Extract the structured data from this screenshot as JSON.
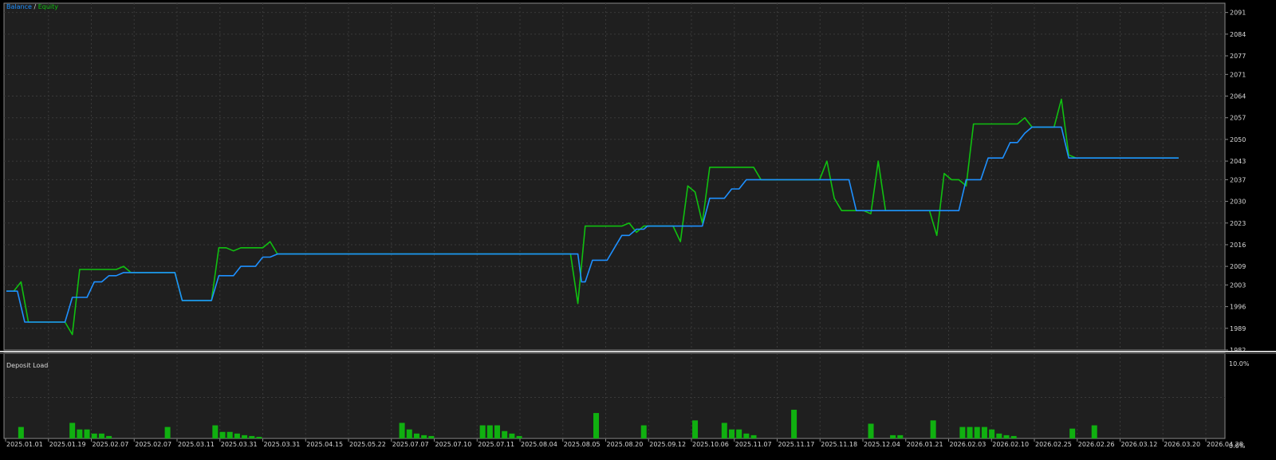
{
  "main_pane": {
    "legend_balance": "Balance",
    "legend_separator": " / ",
    "legend_equity": "Equity"
  },
  "sub_pane": {
    "title": "Deposit Load",
    "y_top_label": "10.0%",
    "y_bottom_label": "0.0%"
  },
  "colors": {
    "background": "#1f1f1f",
    "grid": "#3a3a3a",
    "balance": "#1e90ff",
    "equity": "#10c010",
    "deposit_load": "#10b010",
    "text": "#d8d8d8"
  },
  "chart_data": [
    {
      "type": "line",
      "series": [
        {
          "name": "Balance",
          "x": [
            0,
            3,
            5,
            10,
            12,
            14,
            16,
            18,
            20,
            22,
            24,
            26,
            28,
            30,
            32,
            34,
            36,
            38,
            40,
            42,
            44,
            46,
            48,
            50,
            52,
            54,
            56,
            58,
            60,
            62,
            64,
            66,
            68,
            70,
            72,
            74,
            76,
            78,
            80,
            82,
            84,
            86,
            88,
            90,
            92,
            94,
            96,
            98,
            100,
            102,
            104,
            106,
            108,
            110,
            112,
            114,
            116,
            118,
            120,
            122,
            124,
            126,
            128,
            130,
            132,
            134,
            136,
            138,
            140,
            142,
            144,
            146,
            148,
            150,
            152,
            154,
            156,
            157,
            158,
            160,
            162,
            164,
            166,
            168,
            170,
            172,
            174,
            175,
            176,
            178,
            180,
            182,
            184,
            186,
            188,
            189,
            190,
            192,
            194,
            196,
            198,
            200,
            202,
            204,
            206,
            208,
            210,
            212,
            214,
            216,
            218,
            220,
            222,
            224,
            226,
            228,
            230,
            232,
            234,
            236,
            238,
            240,
            242,
            244,
            246,
            248,
            250,
            252,
            254,
            256,
            258,
            260,
            262,
            264,
            266,
            268,
            270,
            272,
            274,
            276,
            278,
            280,
            282,
            284,
            286,
            288,
            290,
            292,
            294,
            296,
            298,
            300,
            302,
            304,
            306,
            308,
            310,
            312,
            314,
            316,
            318,
            320
          ],
          "y": [
            2001,
            2001,
            1991,
            1991,
            1991,
            1991,
            1991,
            1999,
            1999,
            1999,
            2004,
            2004,
            2006,
            2006,
            2007,
            2007,
            2007,
            2007,
            2007,
            2007,
            2007,
            2007,
            1998,
            1998,
            1998,
            1998,
            1998,
            2006,
            2006,
            2006,
            2009,
            2009,
            2009,
            2012,
            2012,
            2013,
            2013,
            2013,
            2013,
            2013,
            2013,
            2013,
            2013,
            2013,
            2013,
            2013,
            2013,
            2013,
            2013,
            2013,
            2013,
            2013,
            2013,
            2013,
            2013,
            2013,
            2013,
            2013,
            2013,
            2013,
            2013,
            2013,
            2013,
            2013,
            2013,
            2013,
            2013,
            2013,
            2013,
            2013,
            2013,
            2013,
            2013,
            2013,
            2013,
            2013,
            2013,
            2004,
            2004,
            2011,
            2011,
            2011,
            2015,
            2019,
            2019,
            2021,
            2021,
            2022,
            2022,
            2022,
            2022,
            2022,
            2022,
            2022,
            2022,
            2022,
            2022,
            2031,
            2031,
            2031,
            2034,
            2034,
            2037,
            2037,
            2037,
            2037,
            2037,
            2037,
            2037,
            2037,
            2037,
            2037,
            2037,
            2037,
            2037,
            2037,
            2037,
            2027,
            2027,
            2027,
            2027,
            2027,
            2027,
            2027,
            2027,
            2027,
            2027,
            2027,
            2027,
            2027,
            2027,
            2027,
            2037,
            2037,
            2037,
            2044,
            2044,
            2044,
            2049,
            2049,
            2052,
            2054,
            2054,
            2054,
            2054,
            2054,
            2044,
            2044,
            2044,
            2044,
            2044,
            2044,
            2044,
            2044,
            2044,
            2044,
            2044,
            2044,
            2044,
            2044,
            2044,
            2044
          ]
        },
        {
          "name": "Equity",
          "x": [
            0,
            2,
            4,
            6,
            8,
            10,
            12,
            14,
            16,
            18,
            20,
            22,
            24,
            26,
            28,
            30,
            32,
            34,
            36,
            38,
            40,
            42,
            44,
            46,
            48,
            50,
            52,
            54,
            56,
            58,
            60,
            62,
            64,
            66,
            68,
            70,
            72,
            74,
            76,
            78,
            80,
            82,
            84,
            86,
            88,
            90,
            92,
            94,
            96,
            98,
            100,
            102,
            104,
            106,
            108,
            110,
            112,
            114,
            116,
            118,
            120,
            122,
            124,
            126,
            128,
            130,
            132,
            134,
            136,
            138,
            140,
            142,
            144,
            146,
            148,
            150,
            152,
            154,
            156,
            158,
            160,
            162,
            164,
            166,
            168,
            170,
            172,
            174,
            176,
            178,
            180,
            182,
            184,
            186,
            188,
            190,
            192,
            194,
            196,
            198,
            200,
            202,
            204,
            206,
            208,
            210,
            212,
            214,
            216,
            218,
            220,
            222,
            224,
            226,
            228,
            230,
            232,
            234,
            236,
            238,
            240,
            242,
            244,
            246,
            248,
            250,
            252,
            254,
            256,
            258,
            260,
            262,
            264,
            266,
            268,
            270,
            272,
            274,
            276,
            278,
            280,
            282,
            284,
            286,
            288,
            290,
            292,
            294,
            296,
            298,
            300,
            302,
            304,
            306,
            308,
            310,
            312,
            314,
            316,
            318,
            320
          ],
          "y": [
            2001,
            2001,
            2004,
            1991,
            1991,
            1991,
            1991,
            1991,
            1991,
            1987,
            2008,
            2008,
            2008,
            2008,
            2008,
            2008,
            2009,
            2007,
            2007,
            2007,
            2007,
            2007,
            2007,
            2007,
            1998,
            1998,
            1998,
            1998,
            1998,
            2015,
            2015,
            2014,
            2015,
            2015,
            2015,
            2015,
            2017,
            2013,
            2013,
            2013,
            2013,
            2013,
            2013,
            2013,
            2013,
            2013,
            2013,
            2013,
            2013,
            2013,
            2013,
            2013,
            2013,
            2013,
            2013,
            2013,
            2013,
            2013,
            2013,
            2013,
            2013,
            2013,
            2013,
            2013,
            2013,
            2013,
            2013,
            2013,
            2013,
            2013,
            2013,
            2013,
            2013,
            2013,
            2013,
            2013,
            2013,
            2013,
            1997,
            2022,
            2022,
            2022,
            2022,
            2022,
            2022,
            2023,
            2020,
            2022,
            2022,
            2022,
            2022,
            2022,
            2017,
            2035,
            2033,
            2023,
            2041,
            2041,
            2041,
            2041,
            2041,
            2041,
            2041,
            2037,
            2037,
            2037,
            2037,
            2037,
            2037,
            2037,
            2037,
            2037,
            2043,
            2031,
            2027,
            2027,
            2027,
            2027,
            2026,
            2043,
            2027,
            2027,
            2027,
            2027,
            2027,
            2027,
            2027,
            2019,
            2039,
            2037,
            2037,
            2035,
            2055,
            2055,
            2055,
            2055,
            2055,
            2055,
            2055,
            2057,
            2054,
            2054,
            2054,
            2054,
            2063,
            2045,
            2044,
            2044,
            2044,
            2044,
            2044,
            2044,
            2044,
            2044,
            2044,
            2044,
            2044,
            2044,
            2044,
            2044,
            2044
          ]
        }
      ],
      "y_ticks": [
        1982,
        1989,
        1996,
        2003,
        2009,
        2016,
        2023,
        2030,
        2037,
        2043,
        2050,
        2057,
        2064,
        2071,
        2077,
        2084,
        2091
      ],
      "ylim": [
        1982,
        2094
      ],
      "x_tick_labels": [
        "2025.01.01",
        "2025.01.19",
        "2025.02.07",
        "2025.02.07",
        "2025.03.11",
        "2025.03.31",
        "2025.03.31",
        "2025.04.15",
        "2025.05.22",
        "2025.07.07",
        "2025.07.10",
        "2025.07.11",
        "2025.08.04",
        "2025.08.05",
        "2025.08.20",
        "2025.09.12",
        "2025.10.06",
        "2025.11.07",
        "2025.11.17",
        "2025.11.18",
        "2025.12.04",
        "2026.01.21",
        "2026.02.03",
        "2026.02.10",
        "2026.02.25",
        "2026.02.26",
        "2026.03.12",
        "2026.03.20",
        "2026.04.28"
      ],
      "grid": true
    },
    {
      "type": "bar",
      "title": "Deposit Load",
      "ylim": [
        0,
        10
      ],
      "bars": [
        {
          "x": 4,
          "v": 1.4
        },
        {
          "x": 18,
          "v": 1.9
        },
        {
          "x": 20,
          "v": 1.1
        },
        {
          "x": 22,
          "v": 1.1
        },
        {
          "x": 24,
          "v": 0.6
        },
        {
          "x": 26,
          "v": 0.6
        },
        {
          "x": 28,
          "v": 0.3
        },
        {
          "x": 44,
          "v": 1.4
        },
        {
          "x": 57,
          "v": 1.6
        },
        {
          "x": 59,
          "v": 0.8
        },
        {
          "x": 61,
          "v": 0.8
        },
        {
          "x": 63,
          "v": 0.6
        },
        {
          "x": 65,
          "v": 0.4
        },
        {
          "x": 67,
          "v": 0.3
        },
        {
          "x": 69,
          "v": 0.2
        },
        {
          "x": 108,
          "v": 1.9
        },
        {
          "x": 110,
          "v": 1.1
        },
        {
          "x": 112,
          "v": 0.6
        },
        {
          "x": 114,
          "v": 0.4
        },
        {
          "x": 116,
          "v": 0.3
        },
        {
          "x": 130,
          "v": 1.6
        },
        {
          "x": 132,
          "v": 1.6
        },
        {
          "x": 134,
          "v": 1.6
        },
        {
          "x": 136,
          "v": 0.9
        },
        {
          "x": 138,
          "v": 0.6
        },
        {
          "x": 140,
          "v": 0.3
        },
        {
          "x": 161,
          "v": 3.1
        },
        {
          "x": 174,
          "v": 1.6
        },
        {
          "x": 188,
          "v": 2.2
        },
        {
          "x": 196,
          "v": 1.9
        },
        {
          "x": 198,
          "v": 1.1
        },
        {
          "x": 200,
          "v": 1.1
        },
        {
          "x": 202,
          "v": 0.6
        },
        {
          "x": 204,
          "v": 0.4
        },
        {
          "x": 215,
          "v": 3.5
        },
        {
          "x": 236,
          "v": 1.8
        },
        {
          "x": 242,
          "v": 0.4
        },
        {
          "x": 244,
          "v": 0.4
        },
        {
          "x": 253,
          "v": 2.2
        },
        {
          "x": 261,
          "v": 1.4
        },
        {
          "x": 263,
          "v": 1.4
        },
        {
          "x": 265,
          "v": 1.4
        },
        {
          "x": 267,
          "v": 1.4
        },
        {
          "x": 269,
          "v": 1.1
        },
        {
          "x": 271,
          "v": 0.6
        },
        {
          "x": 273,
          "v": 0.4
        },
        {
          "x": 275,
          "v": 0.3
        },
        {
          "x": 291,
          "v": 1.2
        },
        {
          "x": 297,
          "v": 1.6
        }
      ]
    }
  ]
}
